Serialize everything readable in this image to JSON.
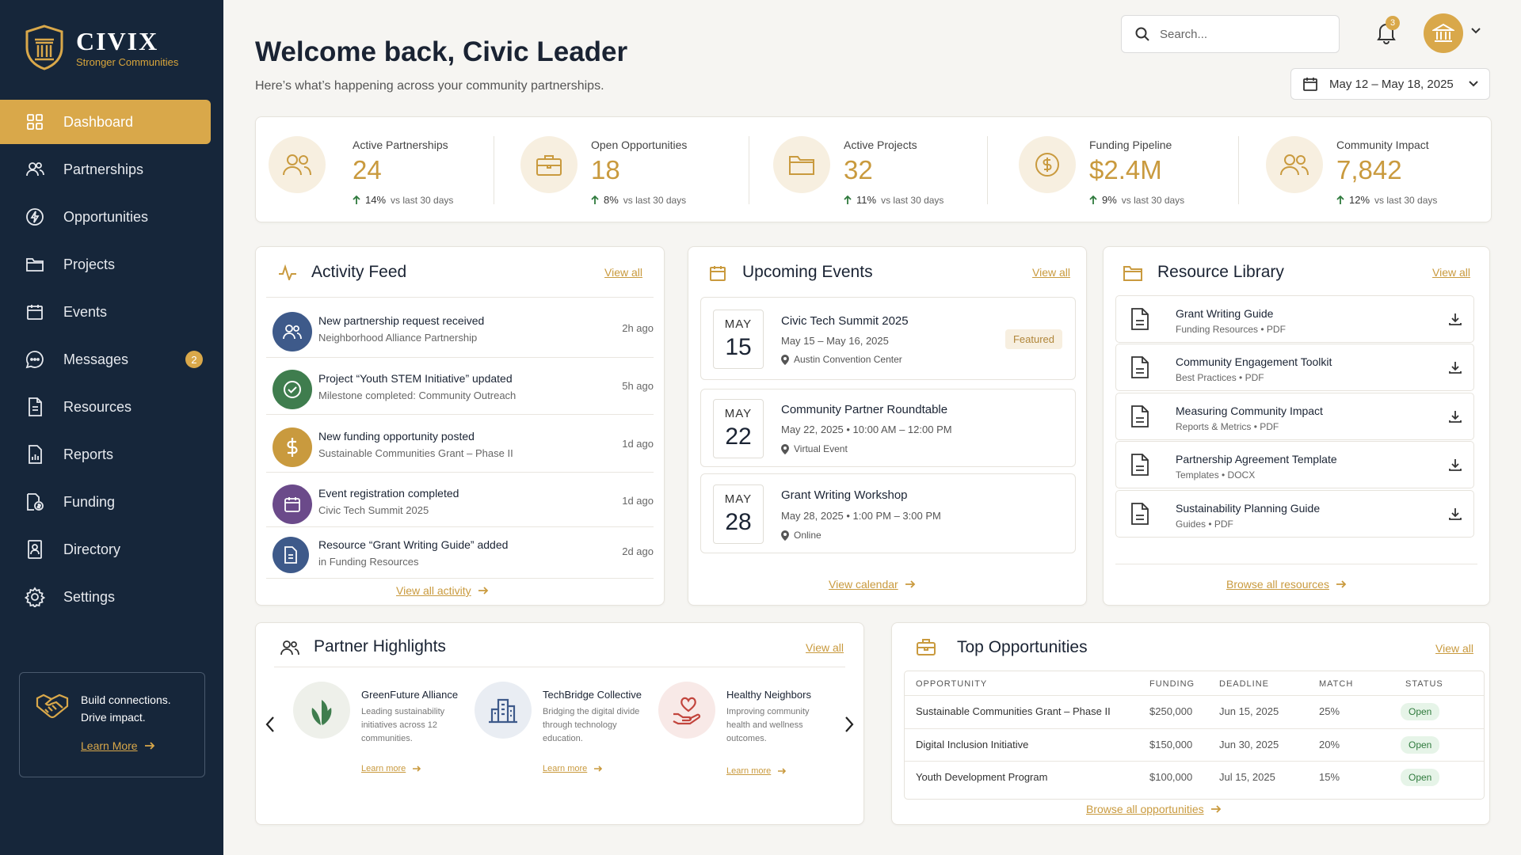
{
  "brand": {
    "name": "CIVIX",
    "tagline": "Stronger Communities"
  },
  "sidebar": {
    "items": [
      {
        "label": "Dashboard",
        "icon": "grid-icon",
        "active": true
      },
      {
        "label": "Partnerships",
        "icon": "people-icon"
      },
      {
        "label": "Opportunities",
        "icon": "bolt-icon"
      },
      {
        "label": "Projects",
        "icon": "folder-icon"
      },
      {
        "label": "Events",
        "icon": "calendar-icon"
      },
      {
        "label": "Messages",
        "icon": "chat-icon",
        "badge": "2"
      },
      {
        "label": "Resources",
        "icon": "document-icon"
      },
      {
        "label": "Reports",
        "icon": "report-icon"
      },
      {
        "label": "Funding",
        "icon": "funding-icon"
      },
      {
        "label": "Directory",
        "icon": "directory-icon"
      },
      {
        "label": "Settings",
        "icon": "gear-icon"
      }
    ],
    "promo": {
      "line1": "Build connections.",
      "line2": "Drive impact.",
      "link": "Learn More"
    }
  },
  "header": {
    "title": "Welcome back, Civic Leader",
    "subtitle": "Here’s what’s happening across your community partnerships.",
    "search_placeholder": "Search...",
    "notifications": "3",
    "date_range": "May 12 – May 18, 2025"
  },
  "colors": {
    "accent": "#d9a84a",
    "sidebar": "#16263a",
    "success": "#2f7a3d"
  },
  "stats": [
    {
      "label": "Active Partnerships",
      "value": "24",
      "trend": "14%",
      "vs": "vs last 30 days",
      "icon": "people-icon"
    },
    {
      "label": "Open Opportunities",
      "value": "18",
      "trend": "8%",
      "vs": "vs last 30 days",
      "icon": "briefcase-icon"
    },
    {
      "label": "Active Projects",
      "value": "32",
      "trend": "11%",
      "vs": "vs last 30 days",
      "icon": "folder-icon"
    },
    {
      "label": "Funding Pipeline",
      "value": "$2.4M",
      "trend": "9%",
      "vs": "vs last 30 days",
      "icon": "dollar-icon"
    },
    {
      "label": "Community Impact",
      "value": "7,842",
      "trend": "12%",
      "vs": "vs last 30 days",
      "icon": "people-icon"
    }
  ],
  "activity": {
    "title": "Activity Feed",
    "view_all": "View all",
    "items": [
      {
        "title": "New partnership request received",
        "sub": "Neighborhood Alliance Partnership",
        "time": "2h ago",
        "color": "#3e5a8a",
        "icon": "people-icon"
      },
      {
        "title": "Project “Youth STEM Initiative” updated",
        "sub": "Milestone completed: Community Outreach",
        "time": "5h ago",
        "color": "#3f7d4e",
        "icon": "check-icon"
      },
      {
        "title": "New funding opportunity posted",
        "sub": "Sustainable Communities Grant – Phase II",
        "time": "1d ago",
        "color": "#c99a3e",
        "icon": "dollar-icon"
      },
      {
        "title": "Event registration completed",
        "sub": "Civic Tech Summit 2025",
        "time": "1d ago",
        "color": "#6b4a8a",
        "icon": "calendar-icon"
      },
      {
        "title": "Resource “Grant Writing Guide” added",
        "sub": "in Funding Resources",
        "time": "2d ago",
        "color": "#3e5a8a",
        "icon": "document-icon"
      }
    ],
    "footer": "View all activity"
  },
  "events": {
    "title": "Upcoming Events",
    "view_all": "View all",
    "items": [
      {
        "month": "MAY",
        "day": "15",
        "title": "Civic Tech Summit 2025",
        "when": "May 15 – May 16, 2025",
        "where": "Austin Convention Center",
        "badge": "Featured"
      },
      {
        "month": "MAY",
        "day": "22",
        "title": "Community Partner Roundtable",
        "when": "May 22, 2025  •  10:00 AM – 12:00 PM",
        "where": "Virtual Event"
      },
      {
        "month": "MAY",
        "day": "28",
        "title": "Grant Writing Workshop",
        "when": "May 28, 2025  •  1:00 PM – 3:00 PM",
        "where": "Online"
      }
    ],
    "footer": "View calendar"
  },
  "resources": {
    "title": "Resource Library",
    "view_all": "View all",
    "items": [
      {
        "title": "Grant Writing Guide",
        "meta": "Funding Resources  •  PDF"
      },
      {
        "title": "Community Engagement Toolkit",
        "meta": "Best Practices  •  PDF"
      },
      {
        "title": "Measuring Community Impact",
        "meta": "Reports & Metrics  •  PDF"
      },
      {
        "title": "Partnership Agreement Template",
        "meta": "Templates  •  DOCX"
      },
      {
        "title": "Sustainability Planning Guide",
        "meta": "Guides  •  PDF"
      }
    ],
    "footer": "Browse all resources"
  },
  "partners": {
    "title": "Partner Highlights",
    "view_all": "View all",
    "items": [
      {
        "name": "GreenFuture Alliance",
        "desc": "Leading sustainability initiatives across 12 communities.",
        "link": "Learn more",
        "icon": "leaf-icon"
      },
      {
        "name": "TechBridge Collective",
        "desc": "Bridging the digital divide through technology education.",
        "link": "Learn more",
        "icon": "building-icon"
      },
      {
        "name": "Healthy Neighbors",
        "desc": "Improving community health and wellness outcomes.",
        "link": "Learn more",
        "icon": "heart-hand-icon"
      }
    ]
  },
  "opportunities": {
    "title": "Top Opportunities",
    "view_all": "View all",
    "columns": [
      "OPPORTUNITY",
      "FUNDING",
      "DEADLINE",
      "MATCH",
      "STATUS"
    ],
    "rows": [
      {
        "name": "Sustainable Communities Grant – Phase II",
        "funding": "$250,000",
        "deadline": "Jun 15, 2025",
        "match": "25%",
        "status": "Open"
      },
      {
        "name": "Digital Inclusion Initiative",
        "funding": "$150,000",
        "deadline": "Jun 30, 2025",
        "match": "20%",
        "status": "Open"
      },
      {
        "name": "Youth Development Program",
        "funding": "$100,000",
        "deadline": "Jul 15, 2025",
        "match": "15%",
        "status": "Open"
      }
    ],
    "footer": "Browse all opportunities"
  }
}
